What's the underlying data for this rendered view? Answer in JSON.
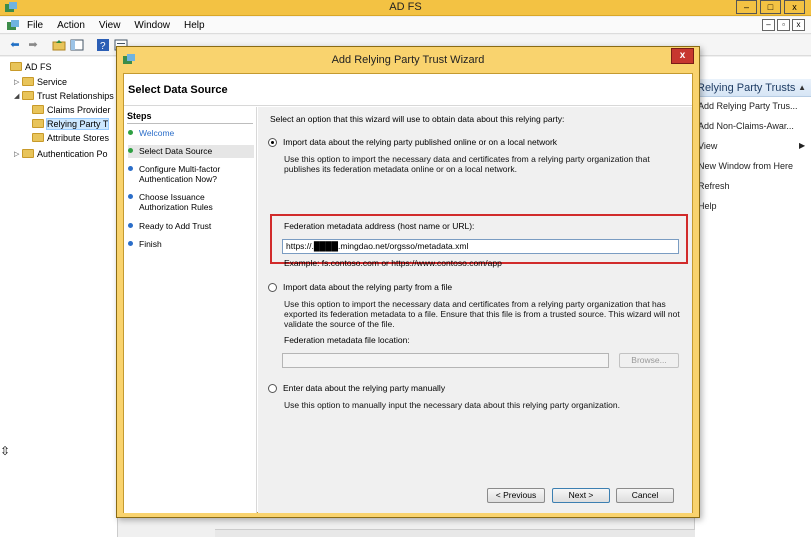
{
  "window": {
    "title": "AD FS",
    "buttons": {
      "minimize": "‒",
      "maximize": "□",
      "close": "x"
    }
  },
  "menu": {
    "items": [
      "File",
      "Action",
      "View",
      "Window",
      "Help"
    ],
    "mdi": {
      "minimize": "‒",
      "restore": "▫",
      "close": "x"
    }
  },
  "tree": {
    "items": [
      {
        "label": "AD FS",
        "arrow": ""
      },
      {
        "label": "Service",
        "arrow": "▷"
      },
      {
        "label": "Trust Relationships",
        "arrow": "◢"
      },
      {
        "label": "Claims Provider",
        "arrow": ""
      },
      {
        "label": "Relying Party T",
        "arrow": ""
      },
      {
        "label": "Attribute Stores",
        "arrow": ""
      },
      {
        "label": "Authentication Po",
        "arrow": "▷"
      }
    ]
  },
  "actions": {
    "header": "Relying Party Trusts",
    "items": [
      "Add Relying Party Trus...",
      "Add Non-Claims-Awar...",
      "View",
      "New Window from Here",
      "Refresh",
      "Help"
    ]
  },
  "dialog": {
    "title": "Add Relying Party Trust Wizard",
    "close": "x",
    "heading": "Select Data Source",
    "steps_title": "Steps",
    "steps": [
      {
        "label": "Welcome",
        "state": "done"
      },
      {
        "label": "Select Data Source",
        "state": "current"
      },
      {
        "label": "Configure Multi-factor Authentication Now?",
        "state": "todo"
      },
      {
        "label": "Choose Issuance Authorization Rules",
        "state": "todo"
      },
      {
        "label": "Ready to Add Trust",
        "state": "todo"
      },
      {
        "label": "Finish",
        "state": "todo"
      }
    ],
    "instruction": "Select an option that this wizard will use to obtain data about this relying party:",
    "option_online": {
      "label": "Import data about the relying party published online or on a local network",
      "description": "Use this option to import the necessary data and certificates from a relying party organization that publishes its federation metadata online or on a local network.",
      "field_label": "Federation metadata address (host name or URL):",
      "value": "https://.████.mingdao.net/orgsso/metadata.xml",
      "example": "Example: fs.contoso.com or https://www.contoso.com/app"
    },
    "option_file": {
      "label": "Import data about the relying party from a file",
      "description": "Use this option to import the necessary data and certificates from a relying party organization that has exported its federation metadata to a file. Ensure that this file is from a trusted source.  This wizard will not validate the source of the file.",
      "field_label": "Federation metadata file location:",
      "value": "",
      "browse": "Browse..."
    },
    "option_manual": {
      "label": "Enter data about the relying party manually",
      "description": "Use this option to manually input the necessary data about this relying party organization."
    },
    "buttons": {
      "previous": "< Previous",
      "next": "Next >",
      "cancel": "Cancel"
    }
  },
  "colors": {
    "title_bar": "#f3c243",
    "dialog_frame": "#f9d36e",
    "highlight_box": "#d12b2b",
    "step_done": "#2b6ec9",
    "step_current": "#2ea043",
    "step_todo": "#2b6ec9"
  }
}
